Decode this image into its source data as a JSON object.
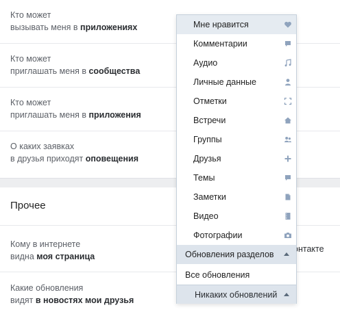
{
  "settings": {
    "rows": [
      {
        "line1": "Кто может",
        "line2_pre": "вызывать меня в ",
        "line2_bold": "приложениях"
      },
      {
        "line1": "Кто может",
        "line2_pre": "приглашать меня в ",
        "line2_bold": "сообщества"
      },
      {
        "line1": "Кто может",
        "line2_pre": "приглашать меня в ",
        "line2_bold": "приложения"
      },
      {
        "line1": "О каких заявках",
        "line2_pre": "в друзья приходят ",
        "line2_bold": "оповещения"
      }
    ],
    "section_title": "Прочее",
    "other_rows": [
      {
        "line1": "Кому в интернете",
        "line2_pre": "видна ",
        "line2_bold": "моя страница"
      },
      {
        "line1": "Какие обновления",
        "line2_pre": "видят ",
        "line2_bold": "в новостях мои друзья"
      }
    ],
    "peek_text": "онтакте"
  },
  "dropdown": {
    "items": [
      {
        "label": "Мне нравится",
        "icon": "heart-icon"
      },
      {
        "label": "Комментарии",
        "icon": "comment-icon"
      },
      {
        "label": "Аудио",
        "icon": "music-note-icon"
      },
      {
        "label": "Личные данные",
        "icon": "person-icon"
      },
      {
        "label": "Отметки",
        "icon": "corners-icon"
      },
      {
        "label": "Встречи",
        "icon": "house-icon"
      },
      {
        "label": "Группы",
        "icon": "group-icon"
      },
      {
        "label": "Друзья",
        "icon": "plus-icon"
      },
      {
        "label": "Темы",
        "icon": "comment-icon"
      },
      {
        "label": "Заметки",
        "icon": "note-icon"
      },
      {
        "label": "Видео",
        "icon": "film-icon"
      },
      {
        "label": "Фотографии",
        "icon": "camera-icon"
      }
    ],
    "group_label": "Обновления разделов",
    "all_label": "Все обновления",
    "selected_value": "Никаких обновлений"
  },
  "colors": {
    "accent": "#8fa3bd",
    "highlight": "#e5ebf1",
    "group_bg": "#dde4ec"
  }
}
